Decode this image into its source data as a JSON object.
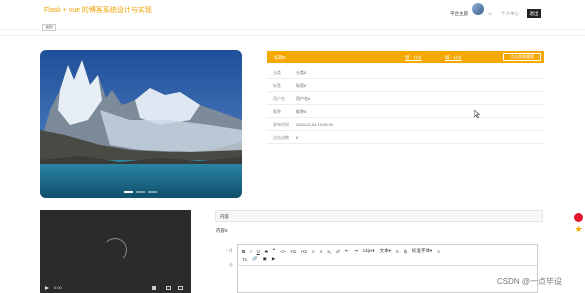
{
  "header": {
    "title": "Flask + vue 的博客系统设计与实现",
    "platform_link": "平台主题",
    "user_name": "11",
    "profile_link": "个人中心",
    "logout_label": "退出"
  },
  "back_label": "返回",
  "carousel": {
    "slide_count": 3,
    "active_index": 0
  },
  "info_panel": {
    "header_title": "标题8",
    "like_label": "赞 · 1(0)",
    "dislike_label": "踩 · 1(0)",
    "favorite_label": "点击我收藏哦",
    "rows": [
      {
        "label": "分类",
        "value": "分类8"
      },
      {
        "label": "标签",
        "value": "标签8"
      },
      {
        "label": "用户名",
        "value": "用户名8"
      },
      {
        "label": "昵称",
        "value": "昵称8"
      },
      {
        "label": "发布时间",
        "value": "2024-02-04 14:05:20"
      },
      {
        "label": "点击次数",
        "value": "8"
      }
    ]
  },
  "video": {
    "time": "0:00"
  },
  "content": {
    "header_label": "内容",
    "text": "内容8"
  },
  "comment": {
    "label": "* 评",
    "sub_label": "论"
  },
  "editor_toolbar": {
    "row1": [
      "B",
      "I",
      "U",
      "S",
      "❝",
      "<>",
      "H1",
      "H2",
      "≡",
      "≡",
      "x₂",
      "x²",
      "⇤",
      "⇥"
    ],
    "size_select": "14px",
    "font_select": "文本",
    "text_color": "A",
    "bg_color": "A",
    "family_select": "标准字体",
    "align": "≡",
    "row2": [
      "Tx",
      "🔗",
      "▣",
      "▶"
    ]
  },
  "watermark": "CSDN @一点毕设",
  "colors": {
    "accent": "#f5a800",
    "title": "#f0a000",
    "video_bg": "#2b2b2b"
  }
}
